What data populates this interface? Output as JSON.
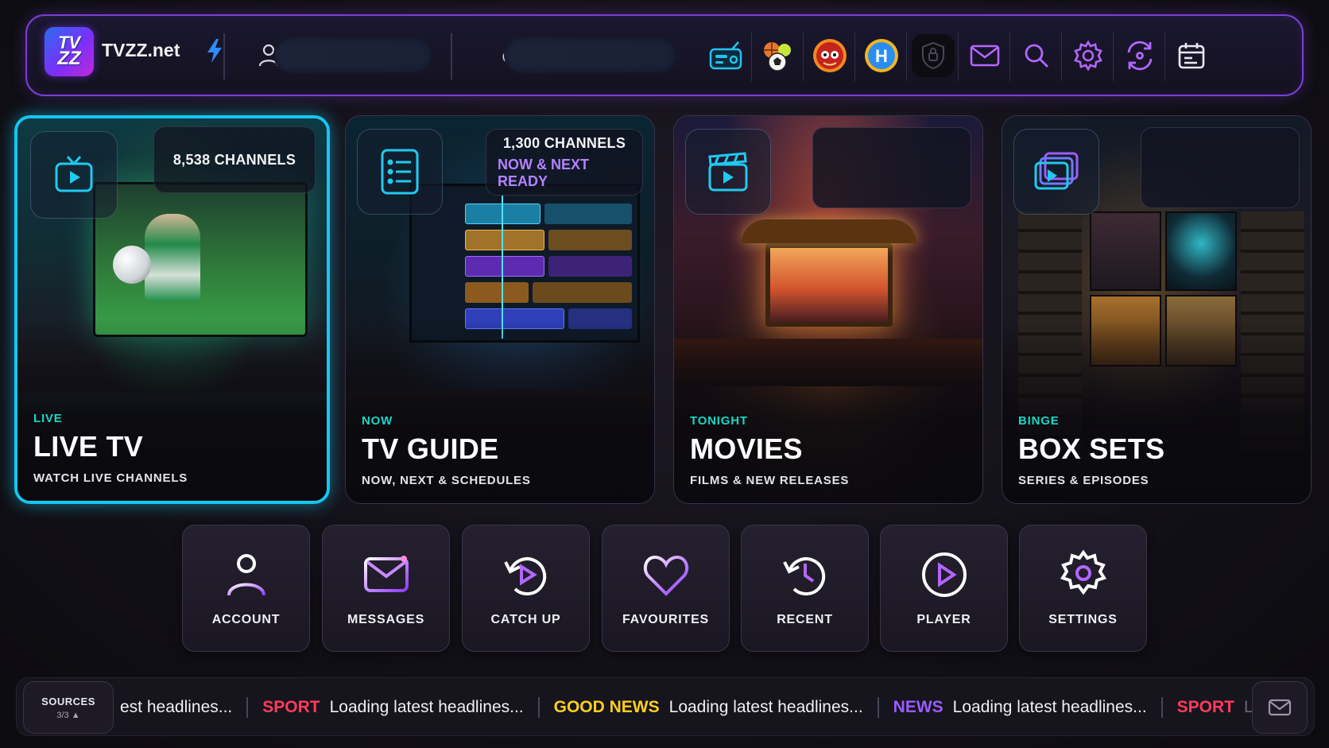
{
  "header": {
    "logo_text_top": "TV",
    "logo_text_bottom": "ZZ",
    "brand": "TVZZ.net",
    "user_pill_value": "",
    "weather_pill_value": "",
    "icons": [
      "radio-icon",
      "sports-balls-icon",
      "cartoon-icon",
      "kids-h-icon",
      "shield-icon",
      "mail-icon",
      "search-icon",
      "gear-icon",
      "sync-icon",
      "calendar-icon"
    ]
  },
  "tiles": [
    {
      "tag": "LIVE",
      "title": "LIVE TV",
      "desc": "WATCH LIVE CHANNELS",
      "count": "8,538  CHANNELS",
      "sub": ""
    },
    {
      "tag": "NOW",
      "title": "TV GUIDE",
      "desc": "NOW, NEXT & SCHEDULES",
      "count": "1,300 CHANNELS",
      "sub": "NOW & NEXT READY"
    },
    {
      "tag": "TONIGHT",
      "title": "MOVIES",
      "desc": "FILMS & NEW RELEASES",
      "count": "",
      "sub": ""
    },
    {
      "tag": "BINGE",
      "title": "BOX SETS",
      "desc": "SERIES & EPISODES",
      "count": "",
      "sub": ""
    }
  ],
  "quick": [
    {
      "label": "ACCOUNT",
      "icon": "account-icon"
    },
    {
      "label": "MESSAGES",
      "icon": "messages-icon"
    },
    {
      "label": "CATCH UP",
      "icon": "catch-up-icon"
    },
    {
      "label": "FAVOURITES",
      "icon": "heart-icon"
    },
    {
      "label": "RECENT",
      "icon": "recent-icon"
    },
    {
      "label": "PLAYER",
      "icon": "play-icon"
    },
    {
      "label": "SETTINGS",
      "icon": "gear-icon"
    }
  ],
  "ticker": {
    "sources_label": "SOURCES",
    "sources_count": "3/3 ▲",
    "items": [
      {
        "cat": "",
        "text": "est headlines...",
        "color": "#ffffff"
      },
      {
        "cat": "SPORT",
        "text": "Loading latest headlines...",
        "color": "#ff3b5c"
      },
      {
        "cat": "GOOD NEWS",
        "text": "Loading latest headlines...",
        "color": "#ffcf1f"
      },
      {
        "cat": "NEWS",
        "text": "Loading latest headlines...",
        "color": "#9b5cff"
      },
      {
        "cat": "SPORT",
        "text": "L",
        "color": "#ff3b5c"
      }
    ]
  },
  "colors": {
    "accent_cyan": "#16c6f0",
    "accent_purple": "#9b5cff",
    "tag_teal": "#19d6c6"
  }
}
